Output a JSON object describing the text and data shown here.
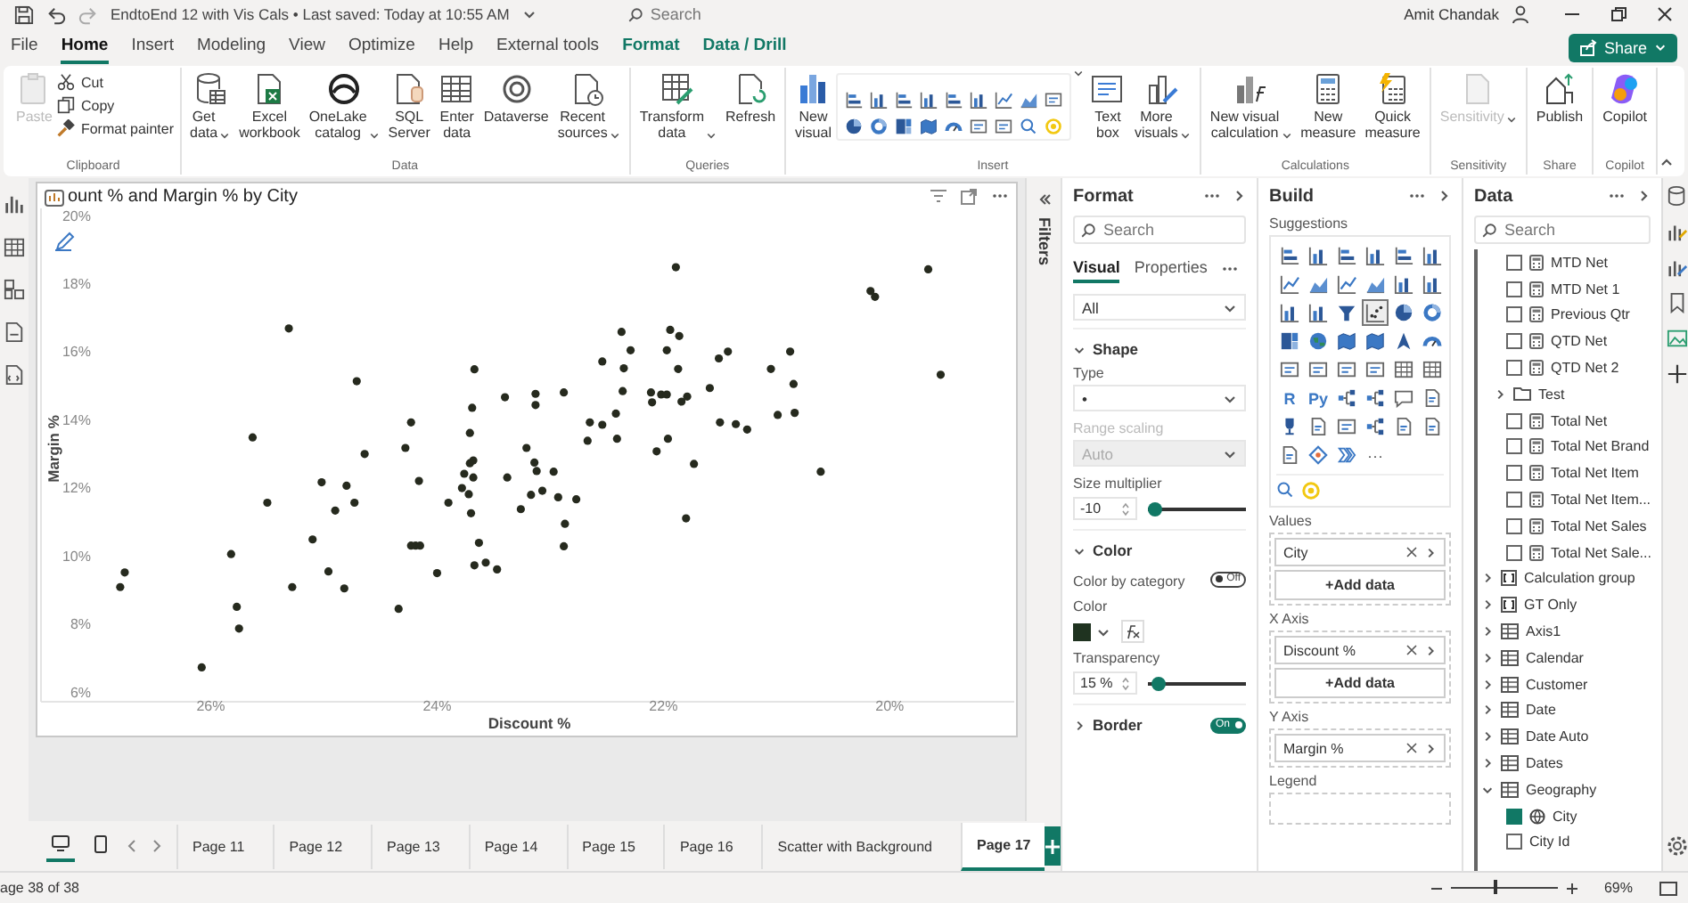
{
  "title_bar": {
    "document": "EndtoEnd 12 with Vis Cals • Last saved: Today at 10:55 AM",
    "search_placeholder": "Search",
    "user": "Amit Chandak"
  },
  "menu": [
    {
      "label": "File",
      "kind": "plain",
      "selected": false
    },
    {
      "label": "Home",
      "kind": "plain",
      "selected": true
    },
    {
      "label": "Insert",
      "kind": "plain",
      "selected": false
    },
    {
      "label": "Modeling",
      "kind": "plain",
      "selected": false
    },
    {
      "label": "View",
      "kind": "plain",
      "selected": false
    },
    {
      "label": "Optimize",
      "kind": "plain",
      "selected": false
    },
    {
      "label": "Help",
      "kind": "plain",
      "selected": false
    },
    {
      "label": "External tools",
      "kind": "plain",
      "selected": false
    },
    {
      "label": "Format",
      "kind": "contextual",
      "selected": false
    },
    {
      "label": "Data / Drill",
      "kind": "contextual",
      "selected": false
    }
  ],
  "share_label": "Share",
  "ribbon": [
    {
      "label": "Clipboard",
      "items": [
        {
          "kind": "large",
          "label": "Paste",
          "dropdown": false,
          "disabled": true
        },
        {
          "kind": "small",
          "label": "Cut",
          "disabled": false
        },
        {
          "kind": "small",
          "label": "Copy",
          "disabled": false
        },
        {
          "kind": "small",
          "label": "Format painter",
          "disabled": false
        }
      ]
    },
    {
      "label": "Data",
      "items": [
        {
          "kind": "large",
          "label": "Get\ndata",
          "dropdown": true,
          "disabled": false
        },
        {
          "kind": "large",
          "label": "Excel\nworkbook",
          "dropdown": false,
          "disabled": false
        },
        {
          "kind": "large",
          "label": "OneLake\ncatalog",
          "dropdown": true,
          "disabled": false
        },
        {
          "kind": "large",
          "label": "SQL\nServer",
          "dropdown": false,
          "disabled": false
        },
        {
          "kind": "large",
          "label": "Enter\ndata",
          "dropdown": false,
          "disabled": false
        },
        {
          "kind": "large",
          "label": "Dataverse",
          "dropdown": false,
          "disabled": false
        },
        {
          "kind": "large",
          "label": "Recent\nsources",
          "dropdown": true,
          "disabled": false
        }
      ]
    },
    {
      "label": "Queries",
      "items": [
        {
          "kind": "large",
          "label": "Transform\ndata",
          "dropdown": true,
          "disabled": false
        },
        {
          "kind": "large",
          "label": "Refresh",
          "dropdown": false,
          "disabled": false
        }
      ]
    },
    {
      "label": "Insert",
      "items": [
        {
          "kind": "large",
          "label": "New\nvisual",
          "dropdown": false,
          "disabled": false
        },
        {
          "kind": "gallery"
        },
        {
          "kind": "large",
          "label": "Text\nbox",
          "dropdown": false,
          "disabled": false
        },
        {
          "kind": "large",
          "label": "More\nvisuals",
          "dropdown": true,
          "disabled": false
        }
      ]
    },
    {
      "label": "Calculations",
      "items": [
        {
          "kind": "large",
          "label": "New visual\ncalculation",
          "dropdown": true,
          "disabled": false
        },
        {
          "kind": "large",
          "label": "New\nmeasure",
          "dropdown": false,
          "disabled": false
        },
        {
          "kind": "large",
          "label": "Quick\nmeasure",
          "dropdown": false,
          "disabled": false
        }
      ]
    },
    {
      "label": "Sensitivity",
      "items": [
        {
          "kind": "large",
          "label": "Sensitivity",
          "dropdown": true,
          "disabled": true
        }
      ]
    },
    {
      "label": "Share",
      "items": [
        {
          "kind": "large",
          "label": "Publish",
          "dropdown": false,
          "disabled": false
        }
      ]
    },
    {
      "label": "Copilot",
      "items": [
        {
          "kind": "large",
          "label": "Copilot",
          "dropdown": false,
          "disabled": false
        }
      ]
    }
  ],
  "visual": {
    "chart_data": {
      "type": "scatter",
      "title": "ount % and Margin % by City",
      "xlabel": "Discount %",
      "ylabel": "Margin %",
      "x": [
        26.8,
        26.76,
        26.08,
        25.82,
        25.77,
        25.75,
        25.63,
        25.5,
        25.31,
        25.28,
        25.1,
        25.02,
        24.96,
        24.9,
        24.82,
        24.8,
        24.73,
        24.71,
        24.64,
        24.34,
        24.28,
        24.23,
        24.23,
        24.19,
        24.15,
        24.16,
        24.0,
        23.9,
        23.78,
        23.76,
        23.72,
        23.71,
        23.71,
        23.7,
        23.69,
        23.68,
        23.68,
        23.67,
        23.67,
        23.63,
        23.57,
        23.47,
        23.4,
        23.38,
        23.26,
        23.21,
        23.17,
        23.14,
        23.13,
        23.13,
        23.12,
        23.07,
        22.97,
        22.93,
        22.88,
        22.88,
        22.87,
        22.77,
        22.67,
        22.65,
        22.54,
        22.54,
        22.42,
        22.41,
        22.37,
        22.36,
        22.35,
        22.29,
        22.11,
        22.1,
        22.06,
        22.02,
        21.97,
        21.97,
        21.96,
        21.94,
        21.89,
        21.87,
        21.86,
        21.84,
        21.8,
        21.79,
        21.73,
        21.59,
        21.51,
        21.5,
        21.43,
        21.36,
        21.26,
        21.05,
        20.99,
        20.88,
        20.85,
        20.84,
        20.61,
        20.17,
        20.13,
        19.66,
        19.55
      ],
      "series": [
        {
          "color": "#262a1e",
          "values": [
            9.07,
            9.5,
            6.71,
            10.04,
            8.49,
            7.85,
            13.47,
            11.55,
            16.67,
            9.07,
            10.47,
            12.15,
            9.53,
            11.32,
            9.03,
            12.05,
            11.55,
            15.12,
            12.98,
            8.43,
            13.16,
            13.91,
            10.29,
            10.29,
            10.29,
            12.19,
            9.48,
            11.55,
            11.98,
            12.4,
            11.8,
            12.71,
            13.6,
            11.24,
            14.34,
            12.79,
            12.29,
            15.47,
            9.71,
            10.37,
            9.79,
            9.59,
            14.65,
            12.29,
            11.36,
            13.16,
            11.78,
            12.73,
            14.42,
            14.75,
            12.48,
            11.9,
            12.46,
            11.71,
            10.27,
            14.79,
            10.93,
            11.65,
            13.37,
            13.91,
            13.84,
            15.7,
            14.17,
            13.43,
            16.57,
            14.83,
            15.5,
            16.03,
            14.79,
            14.5,
            13.06,
            14.73,
            14.73,
            16.03,
            13.43,
            16.63,
            18.47,
            15.48,
            16.45,
            14.52,
            11.09,
            14.67,
            12.69,
            14.92,
            15.79,
            13.91,
            15.99,
            13.86,
            13.7,
            15.48,
            14.13,
            15.99,
            15.04,
            14.19,
            12.46,
            17.77,
            17.6,
            18.41,
            15.31
          ]
        }
      ],
      "xlim": [
        27.5,
        18.9
      ],
      "ylim": [
        5.7,
        20.2
      ],
      "xticks": [
        {
          "value": 26,
          "label": "26%"
        },
        {
          "value": 24,
          "label": "24%"
        },
        {
          "value": 22,
          "label": "22%"
        },
        {
          "value": 20,
          "label": "20%"
        }
      ],
      "yticks": [
        {
          "value": 6,
          "label": "6%"
        },
        {
          "value": 8,
          "label": "8%"
        },
        {
          "value": 10,
          "label": "10%"
        },
        {
          "value": 12,
          "label": "12%"
        },
        {
          "value": 14,
          "label": "14%"
        },
        {
          "value": 16,
          "label": "16%"
        },
        {
          "value": 18,
          "label": "18%"
        },
        {
          "value": 20,
          "label": "20%"
        }
      ]
    }
  },
  "filters_label": "Filters",
  "format_pane": {
    "title": "Format",
    "search_placeholder": "Search",
    "tabs": [
      {
        "label": "Visual",
        "selected": true
      },
      {
        "label": "Properties",
        "selected": false
      }
    ],
    "filter_value": "All",
    "sections": [
      {
        "title": "Shape",
        "expanded": true,
        "controls": [
          {
            "kind": "dropdown",
            "label": "Type",
            "value": "•",
            "disabled": false
          },
          {
            "kind": "dropdown",
            "label": "Range scaling",
            "value": "Auto",
            "disabled": true
          },
          {
            "kind": "slider",
            "label": "Size multiplier",
            "value": "-10",
            "level": 0.08
          }
        ]
      },
      {
        "title": "Color",
        "expanded": true,
        "controls": [
          {
            "kind": "toggle",
            "label": "Color by category",
            "on": false,
            "state_label": "Off"
          },
          {
            "kind": "color",
            "label": "Color",
            "color": "#1f3320"
          },
          {
            "kind": "slider",
            "label": "Transparency",
            "value": "15 %",
            "level": 0.1
          }
        ]
      },
      {
        "title": "Border",
        "expanded": false,
        "toggle": {
          "on": true,
          "state_label": "On"
        }
      }
    ]
  },
  "build_pane": {
    "title": "Build",
    "suggestions_label": "Suggestions",
    "suggestions": [
      {
        "kind": "hbar",
        "selected": false
      },
      {
        "kind": "vbar",
        "selected": false
      },
      {
        "kind": "hbar",
        "selected": false
      },
      {
        "kind": "vbar",
        "selected": false
      },
      {
        "kind": "hbar",
        "selected": false
      },
      {
        "kind": "vbar",
        "selected": false
      },
      {
        "kind": "line",
        "selected": false
      },
      {
        "kind": "area",
        "selected": false
      },
      {
        "kind": "line",
        "selected": false
      },
      {
        "kind": "area",
        "selected": false
      },
      {
        "kind": "vbar",
        "selected": false
      },
      {
        "kind": "vbar",
        "selected": false
      },
      {
        "kind": "vbar",
        "selected": false
      },
      {
        "kind": "vbar",
        "selected": false
      },
      {
        "kind": "funnel",
        "selected": false
      },
      {
        "kind": "scatter",
        "selected": true
      },
      {
        "kind": "pie",
        "selected": false
      },
      {
        "kind": "donut",
        "selected": false
      },
      {
        "kind": "treemap",
        "selected": false
      },
      {
        "kind": "globe",
        "selected": false
      },
      {
        "kind": "map",
        "selected": false
      },
      {
        "kind": "map",
        "selected": false
      },
      {
        "kind": "arrow",
        "selected": false
      },
      {
        "kind": "gauge",
        "selected": false
      },
      {
        "kind": "card",
        "selected": false
      },
      {
        "kind": "card",
        "selected": false
      },
      {
        "kind": "card",
        "selected": false
      },
      {
        "kind": "card",
        "selected": false
      },
      {
        "kind": "table",
        "selected": false
      },
      {
        "kind": "table",
        "selected": false
      },
      {
        "kind": "glyph",
        "label": "R",
        "selected": false
      },
      {
        "kind": "glyph",
        "label": "Py",
        "selected": false
      },
      {
        "kind": "hierarchy",
        "selected": false
      },
      {
        "kind": "hierarchy",
        "selected": false
      },
      {
        "kind": "chat",
        "selected": false
      },
      {
        "kind": "doc",
        "selected": false
      },
      {
        "kind": "trophy",
        "selected": false
      },
      {
        "kind": "doc",
        "selected": false
      },
      {
        "kind": "card",
        "selected": false
      },
      {
        "kind": "hierarchy",
        "selected": false
      },
      {
        "kind": "doc",
        "selected": false
      },
      {
        "kind": "doc",
        "selected": false
      },
      {
        "kind": "doc",
        "selected": false
      },
      {
        "kind": "diamond",
        "selected": false
      },
      {
        "kind": "chevrons",
        "selected": false
      }
    ],
    "more_label": "···",
    "wells": [
      {
        "label": "Values",
        "fields": [
          "City"
        ],
        "add_label": "+Add data"
      },
      {
        "label": "X Axis",
        "fields": [
          "Discount %"
        ],
        "add_label": "+Add data"
      },
      {
        "label": "Y Axis",
        "fields": [
          "Margin %"
        ]
      },
      {
        "label": "Legend"
      }
    ]
  },
  "data_pane": {
    "title": "Data",
    "search_placeholder": "Search",
    "items": [
      {
        "kind": "measure",
        "label": "MTD Net",
        "checked": false
      },
      {
        "kind": "measure",
        "label": "MTD Net 1",
        "checked": false
      },
      {
        "kind": "measure",
        "label": "Previous Qtr",
        "checked": false
      },
      {
        "kind": "measure",
        "label": "QTD Net",
        "checked": false
      },
      {
        "kind": "measure",
        "label": "QTD Net 2",
        "checked": false
      },
      {
        "kind": "folder",
        "label": "Test",
        "expanded": false
      },
      {
        "kind": "measure",
        "label": "Total Net",
        "checked": false
      },
      {
        "kind": "measure",
        "label": "Total Net Brand",
        "checked": false
      },
      {
        "kind": "measure",
        "label": "Total Net Item",
        "checked": false
      },
      {
        "kind": "measure",
        "label": "Total Net Item...",
        "checked": false
      },
      {
        "kind": "measure",
        "label": "Total Net Sales",
        "checked": false
      },
      {
        "kind": "measure",
        "label": "Total Net Sale...",
        "checked": false
      },
      {
        "kind": "calc_group",
        "label": "Calculation group",
        "expanded": false
      },
      {
        "kind": "calc_group",
        "label": "GT Only",
        "expanded": false
      },
      {
        "kind": "table",
        "label": "Axis1",
        "expanded": false
      },
      {
        "kind": "table",
        "label": "Calendar",
        "expanded": false
      },
      {
        "kind": "table",
        "label": "Customer",
        "expanded": false
      },
      {
        "kind": "table",
        "label": "Date",
        "expanded": false
      },
      {
        "kind": "table",
        "label": "Date Auto",
        "expanded": false
      },
      {
        "kind": "table",
        "label": "Dates",
        "expanded": false
      },
      {
        "kind": "table",
        "label": "Geography",
        "expanded": true,
        "children": [
          {
            "kind": "geo_field",
            "label": "City",
            "checked": true
          },
          {
            "kind": "field",
            "label": "City Id",
            "checked": false
          }
        ]
      }
    ]
  },
  "views": [
    {
      "kind": "desktop",
      "selected": true
    },
    {
      "kind": "phone",
      "selected": false
    }
  ],
  "pages": [
    {
      "label": "Page 11",
      "selected": false
    },
    {
      "label": "Page 12",
      "selected": false
    },
    {
      "label": "Page 13",
      "selected": false
    },
    {
      "label": "Page 14",
      "selected": false
    },
    {
      "label": "Page 15",
      "selected": false
    },
    {
      "label": "Page 16",
      "selected": false
    },
    {
      "label": "Scatter with Background",
      "selected": false
    },
    {
      "label": "Page 17",
      "selected": true
    }
  ],
  "status": {
    "page_label": "age 38 of 38",
    "zoom": {
      "label": "69%",
      "level": 0.4
    }
  }
}
